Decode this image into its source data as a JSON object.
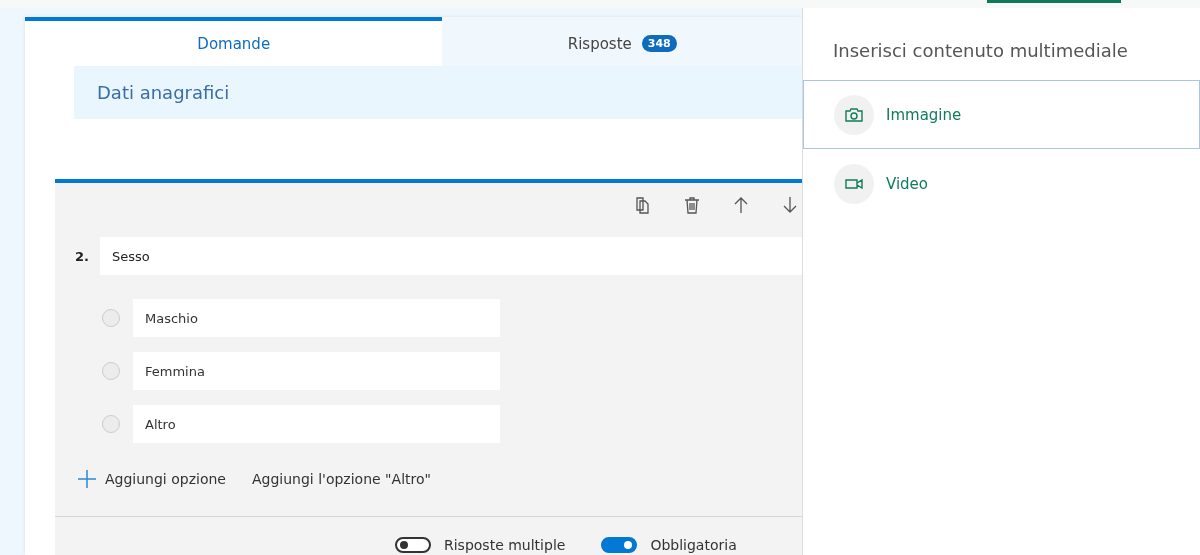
{
  "tabs": [
    {
      "label": "Domande",
      "selected": true
    },
    {
      "label": "Risposte",
      "selected": false,
      "badge": "348"
    }
  ],
  "section": {
    "title": "Dati anagrafici"
  },
  "question": {
    "number": "2.",
    "title": "Sesso",
    "options": [
      {
        "label": "Maschio",
        "selected": false
      },
      {
        "label": "Femmina",
        "selected": false
      },
      {
        "label": "Altro",
        "selected": false
      }
    ],
    "add_option": "Aggiungi opzione",
    "add_other": "Aggiungi l'opzione \"Altro\"",
    "toggles": [
      {
        "label": "Risposte multiple",
        "on": false
      },
      {
        "label": "Obbligatoria",
        "on": true
      }
    ]
  },
  "media_panel": {
    "title": "Inserisci contenuto multimediale",
    "items": [
      {
        "kind": "image",
        "label": "Immagine",
        "selected": true
      },
      {
        "kind": "video",
        "label": "Video",
        "selected": false
      }
    ]
  }
}
